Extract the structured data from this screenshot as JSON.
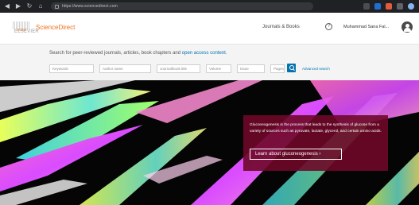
{
  "browser": {
    "url": "https://www.sciencedirect.com",
    "icons": [
      "back-icon",
      "forward-icon",
      "reload-icon",
      "home-icon",
      "lock-icon",
      "extension-icons",
      "profile-icon"
    ]
  },
  "header": {
    "brand": "ScienceDirect",
    "logo_text": "ELSEVIER",
    "journals_link": "Journals & Books",
    "help_icon": "?",
    "user_name": "Muhammad Sana Fal..."
  },
  "search": {
    "prompt": "Search for peer-reviewed journals, articles, book chapters and ",
    "prompt_link": "open access content.",
    "fields": {
      "keywords": "Keywords",
      "author": "Author name",
      "journal": "Journal/book title",
      "volume": "Volume",
      "issue": "Issue",
      "pages": "Pages"
    },
    "advanced": "Advanced search"
  },
  "hero": {
    "caption": "Gluconeogenesis is the process that leads to the synthesis of glucose from a variety of sources such as pyruvate, lactate, glycerol, and certain amino acids.",
    "button": "Learn about gluconeogenesis",
    "accent_color": "#6e0828"
  },
  "colors": {
    "brand_orange": "#e9711c",
    "link_blue": "#0272b1"
  }
}
